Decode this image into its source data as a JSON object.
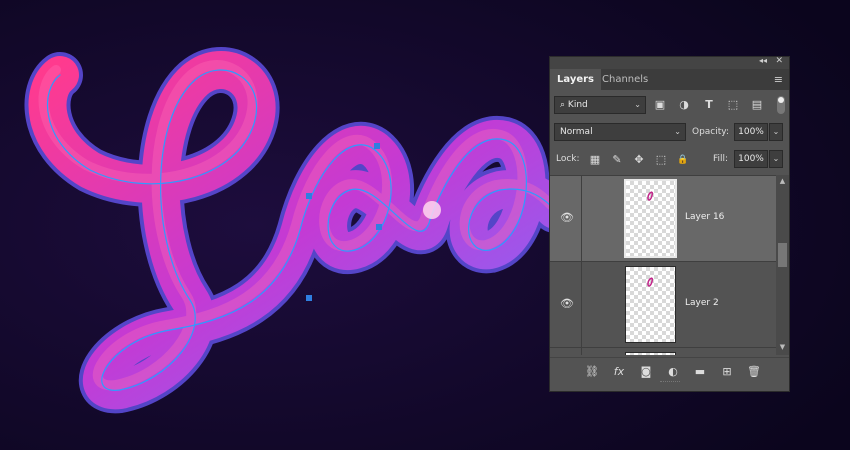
{
  "panel": {
    "collapse_glyph": "◂◂",
    "close_glyph": "✕",
    "tabs": [
      {
        "label": "Layers",
        "active": true
      },
      {
        "label": "Channels",
        "active": false
      }
    ],
    "menu_glyph": "≡",
    "filter": {
      "kind_label": "Kind",
      "search_glyph": "⌕",
      "chevron": "⌄",
      "icons": [
        {
          "name": "image-filter-icon",
          "glyph": "▣"
        },
        {
          "name": "adjustment-filter-icon",
          "glyph": "◑"
        },
        {
          "name": "type-filter-icon",
          "glyph": "T"
        },
        {
          "name": "shape-filter-icon",
          "glyph": "⬚"
        },
        {
          "name": "smart-object-filter-icon",
          "glyph": "▤"
        }
      ]
    },
    "blend": {
      "mode": "Normal",
      "opacity_label": "Opacity:",
      "opacity_value": "100%",
      "fill_label": "Fill:",
      "fill_value": "100%",
      "dropdown_glyph": "⌄"
    },
    "lock": {
      "label": "Lock:",
      "icons": [
        {
          "name": "lock-transparent-pixels-icon",
          "glyph": "▦"
        },
        {
          "name": "lock-image-pixels-icon",
          "glyph": "✎"
        },
        {
          "name": "lock-position-icon",
          "glyph": "✥"
        },
        {
          "name": "lock-artboard-icon",
          "glyph": "⬚"
        },
        {
          "name": "lock-all-icon",
          "glyph": "🔒"
        }
      ]
    },
    "layers": [
      {
        "name": "Layer 16",
        "visible": true,
        "selected": true
      },
      {
        "name": "Layer 2",
        "visible": true,
        "selected": false
      }
    ],
    "eye_glyph": "👁",
    "scroll": {
      "up": "▲",
      "down": "▼"
    },
    "bottom_icons": [
      {
        "name": "link-layers-icon",
        "glyph": "⛓"
      },
      {
        "name": "layer-style-fx-icon",
        "glyph": "fx"
      },
      {
        "name": "add-mask-icon",
        "glyph": "◙"
      },
      {
        "name": "new-adjustment-layer-icon",
        "glyph": "◐"
      },
      {
        "name": "new-group-folder-icon",
        "glyph": "▬"
      },
      {
        "name": "new-layer-icon",
        "glyph": "⊞"
      },
      {
        "name": "delete-layer-icon",
        "glyph": "🗑"
      }
    ]
  },
  "canvas": {
    "artwork": "3D tube lettering",
    "colors": {
      "pink": "#e0298a",
      "magenta": "#c23dd0",
      "violet": "#8a6cf5",
      "bg": "#0c0620",
      "path": "#2f9bff"
    }
  }
}
